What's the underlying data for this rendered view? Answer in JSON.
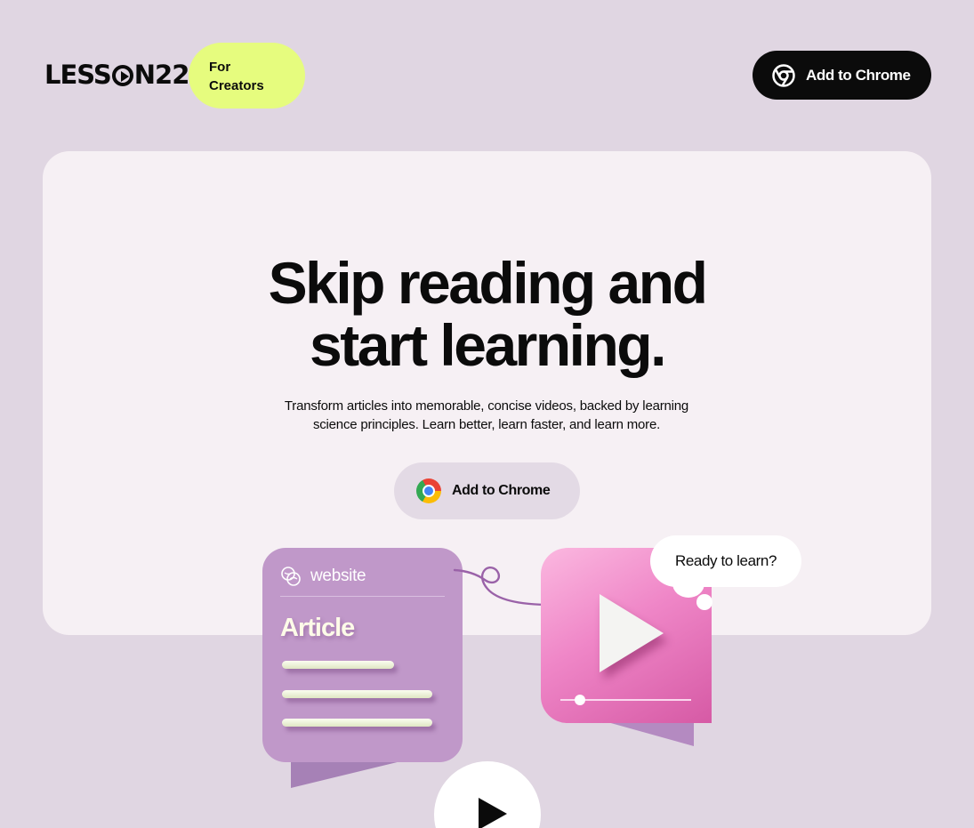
{
  "header": {
    "logo_left": "LESS",
    "logo_right": "N22",
    "creators_badge": "For Creators",
    "cta_label": "Add to Chrome"
  },
  "hero": {
    "headline_line1": "Skip reading and",
    "headline_line2": "start learning.",
    "subtitle": "Transform articles into memorable, concise videos, backed by learning science principles. Learn better, learn faster, and learn more.",
    "cta_label": "Add to Chrome"
  },
  "illustration": {
    "article_source": "website",
    "article_title": "Article",
    "bubble_text": "Ready to learn?",
    "video_progress": 0.15
  },
  "colors": {
    "background": "#e0d6e2",
    "card": "#f6f0f4",
    "badge": "#e6fc7e",
    "dark": "#0b0b0b",
    "article": "#c098c9",
    "video": "#ef86c7"
  },
  "icons": [
    "chrome-icon",
    "chrome-color-icon",
    "globe-icon",
    "play-icon",
    "arrow-icon"
  ]
}
